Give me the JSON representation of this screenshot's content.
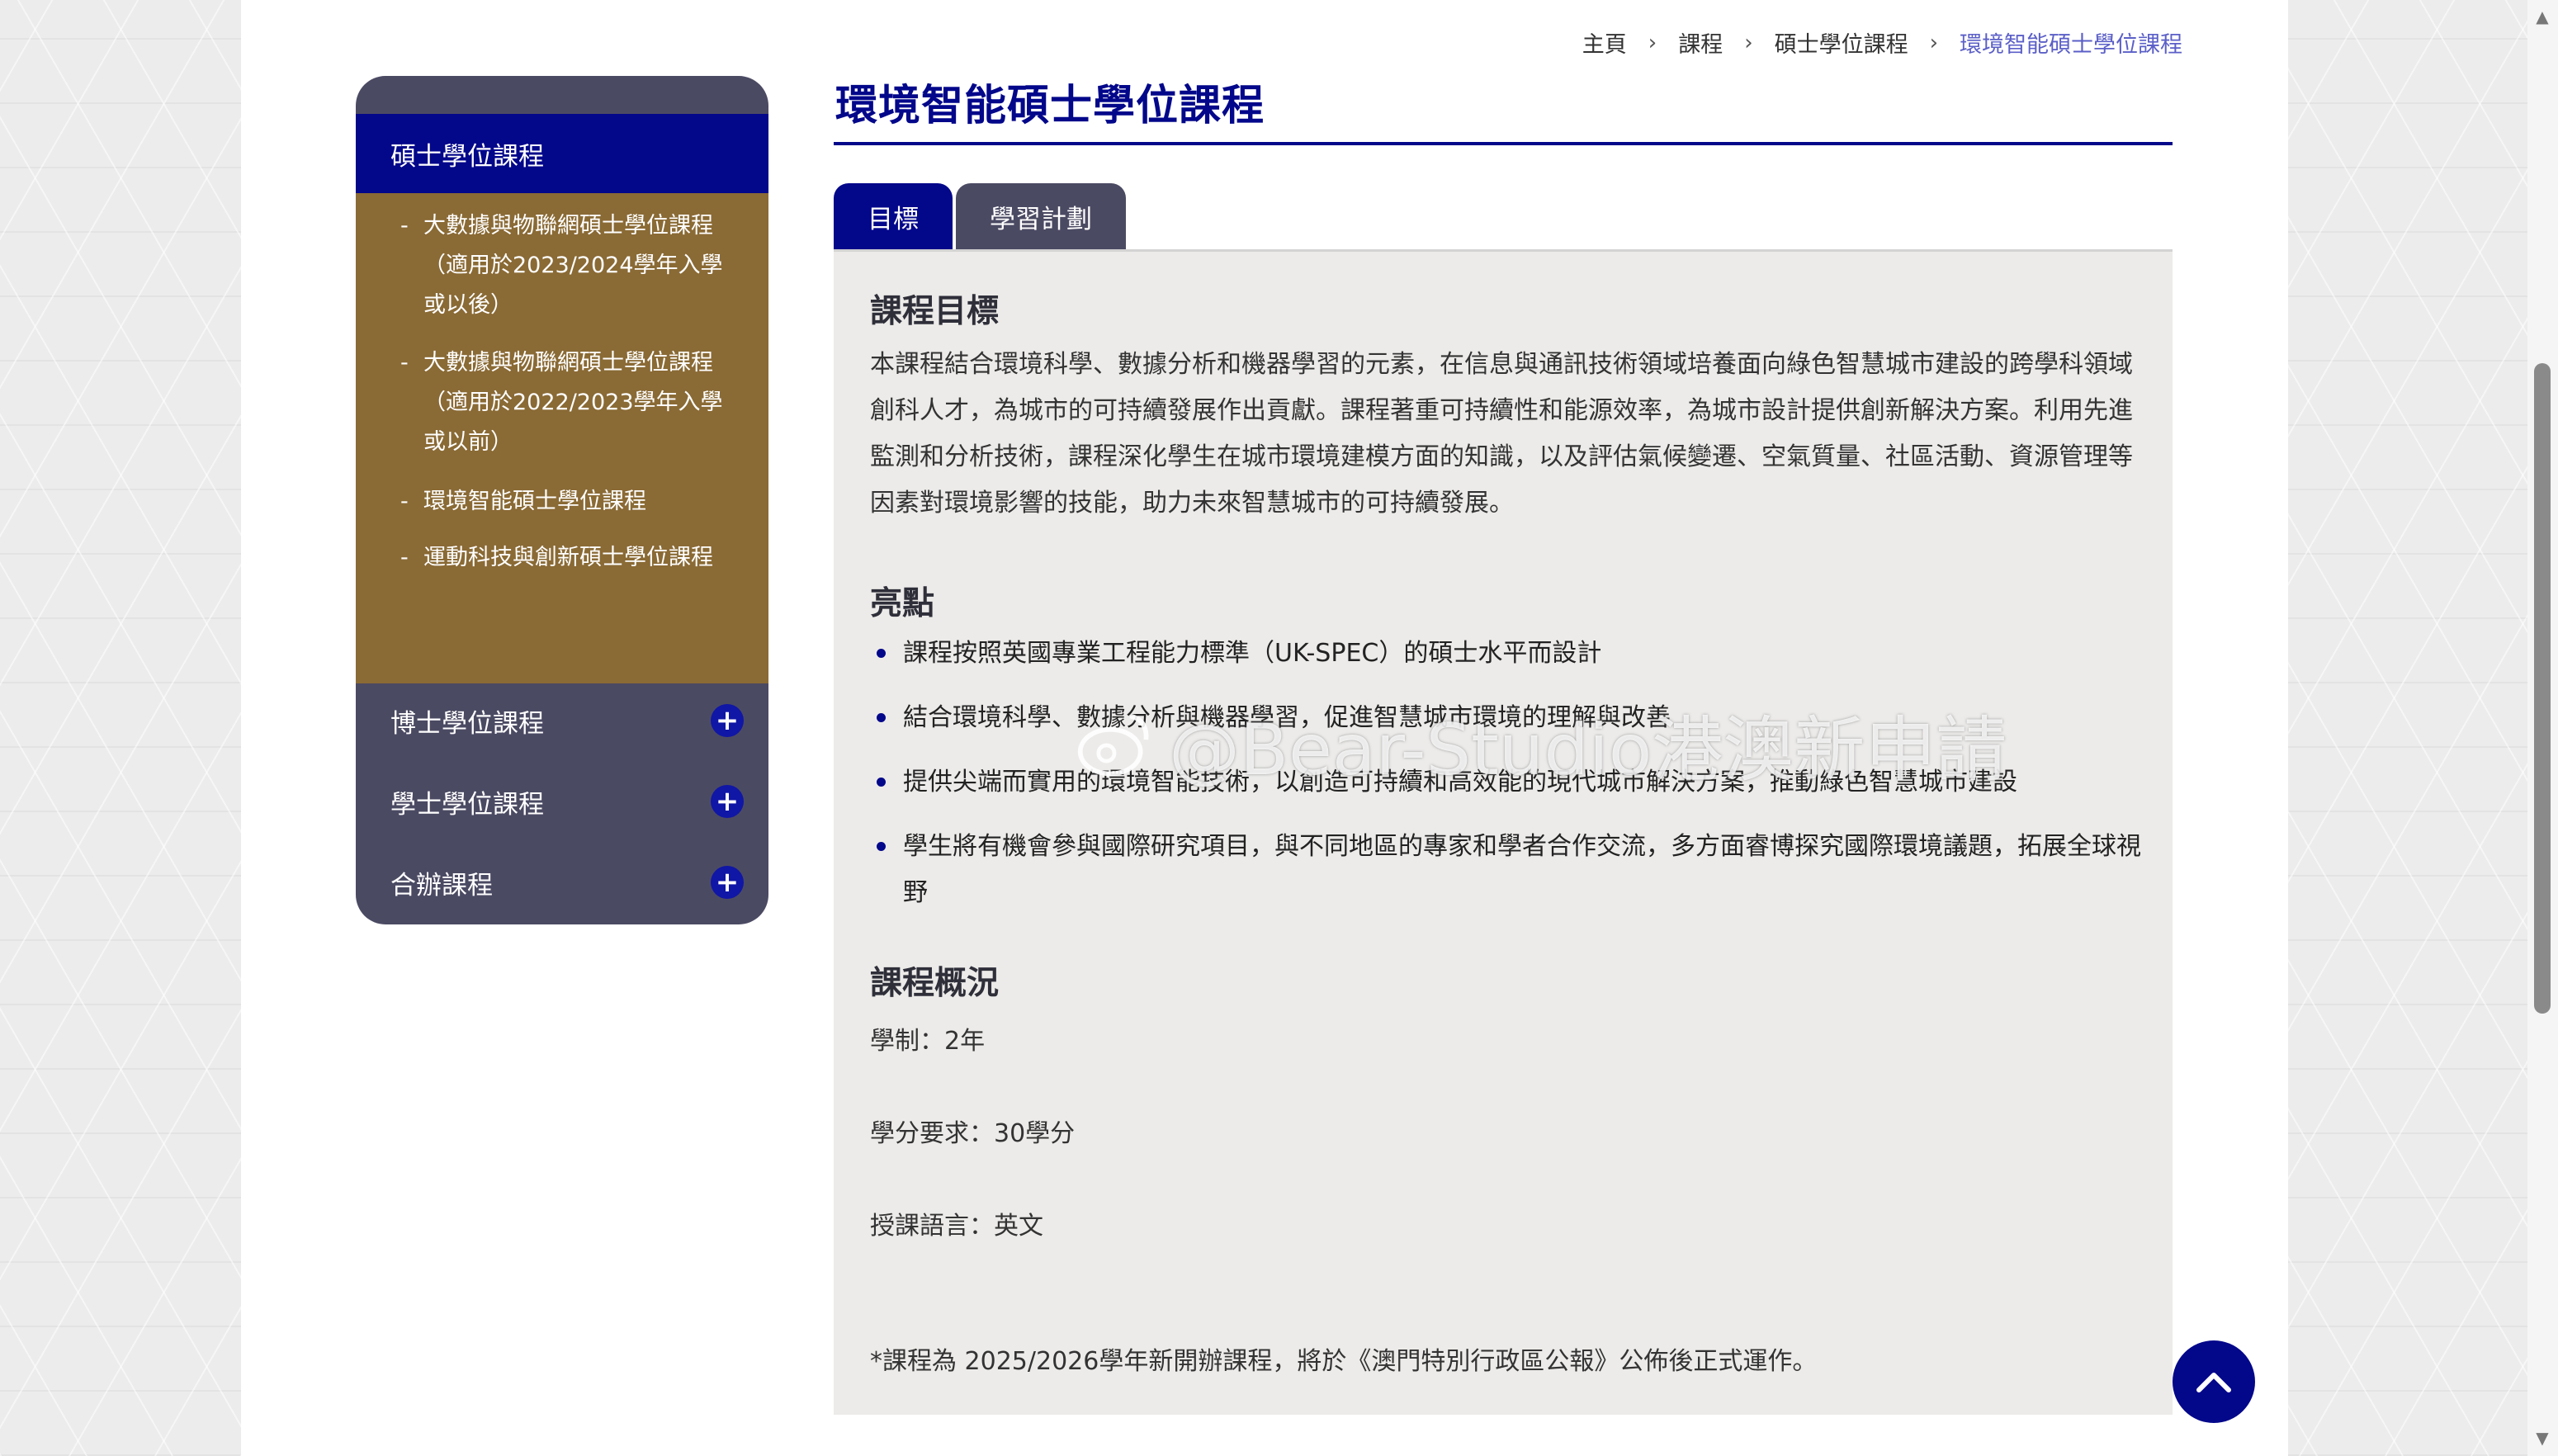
{
  "breadcrumb": {
    "items": [
      "主頁",
      "課程",
      "碩士學位課程",
      "環境智能碩士學位課程"
    ],
    "separator": "›"
  },
  "page_title": "環境智能碩士學位課程",
  "sidebar": {
    "active_section": "碩士學位課程",
    "sub_items": [
      {
        "label": "大數據與物聯網碩士學位課程（適用於2023/2024學年入學或以後）",
        "lines": [
          "大數據與物聯網碩士學位課程",
          "（適用於2023/2024學年入學",
          "或以後）"
        ]
      },
      {
        "label": "大數據與物聯網碩士學位課程（適用於2022/2023學年入學或以前）",
        "lines": [
          "大數據與物聯網碩士學位課程",
          "（適用於2022/2023學年入學",
          "或以前）"
        ]
      },
      {
        "label": "環境智能碩士學位課程",
        "lines": [
          "環境智能碩士學位課程"
        ]
      },
      {
        "label": "運動科技與創新碩士學位課程",
        "lines": [
          "運動科技與創新碩士學位課程"
        ]
      }
    ],
    "sections": [
      {
        "label": "博士學位課程",
        "icon": "plus-icon"
      },
      {
        "label": "學士學位課程",
        "icon": "plus-icon"
      },
      {
        "label": "合辦課程",
        "icon": "plus-icon"
      }
    ]
  },
  "tabs": [
    {
      "label": "目標",
      "active": true
    },
    {
      "label": "學習計劃",
      "active": false
    }
  ],
  "content": {
    "objective_heading": "課程目標",
    "objective_text": "本課程結合環境科學、數據分析和機器學習的元素，在信息與通訊技術領域培養面向綠色智慧城市建設的跨學科領域創科人才，為城市的可持續發展作出貢獻。課程著重可持續性和能源效率，為城市設計提供創新解決方案。利用先進監測和分析技術，課程深化學生在城市環境建模方面的知識，以及評估氣候變遷、空氣質量、社區活動、資源管理等因素對環境影響的技能，助力未來智慧城市的可持續發展。",
    "highlights_heading": "亮點",
    "highlights": [
      "課程按照英國專業工程能力標準（UK-SPEC）的碩士水平而設計",
      "結合環境科學、數據分析與機器學習，促進智慧城市環境的理解與改善",
      "提供尖端而實用的環境智能技術，以創造可持續和高效能的現代城市解決方案，推動綠色智慧城市建設",
      "學生將有機會參與國際研究項目，與不同地區的專家和學者合作交流，多方面睿博探究國際環境議題，拓展全球視野"
    ],
    "overview_heading": "課程概況",
    "facts": [
      {
        "label": "學制：2年"
      },
      {
        "label": "學分要求：30學分"
      },
      {
        "label": "授課語言：英文"
      }
    ],
    "note": "*課程為 2025/2026學年新開辦課程，將於《澳門特別行政區公報》公佈後正式運作。"
  },
  "watermark": "@Bear-Studio港澳新申請",
  "colors": {
    "primary": "#03078a",
    "sidebar_bg": "#4b4a63",
    "submenu_bg": "#8a6a35",
    "panel_bg": "#ecebe9",
    "breadcrumb_current": "#5b5fc7"
  },
  "icons": {
    "scroll_top": "chevron-up-icon",
    "expand": "plus-icon"
  }
}
